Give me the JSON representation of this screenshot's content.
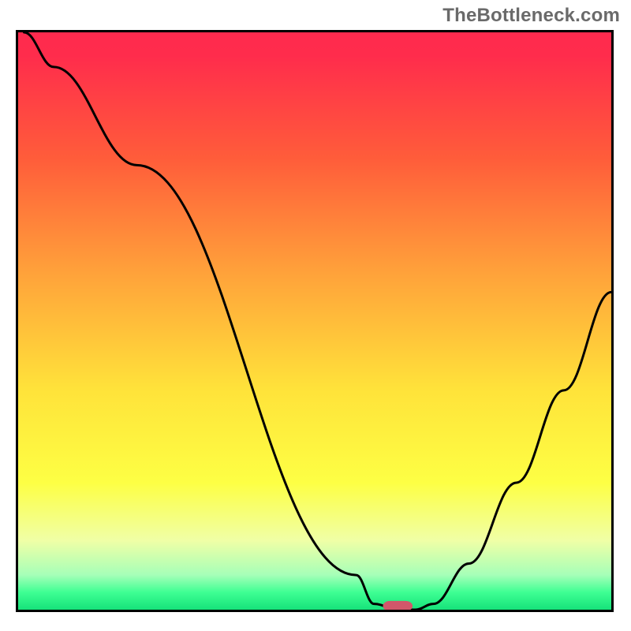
{
  "watermark": "TheBottleneck.com",
  "chart_data": {
    "type": "line",
    "title": "",
    "xlabel": "",
    "ylabel": "",
    "xlim": [
      0,
      100
    ],
    "ylim": [
      0,
      100
    ],
    "grid": false,
    "series": [
      {
        "name": "curve",
        "x": [
          1,
          6,
          20,
          57,
          60,
          64,
          67,
          70,
          76,
          84,
          92,
          100
        ],
        "y": [
          100,
          94,
          77,
          6,
          1,
          0,
          0,
          1,
          8,
          22,
          38,
          55
        ]
      }
    ],
    "marker": {
      "x": 64,
      "y": 0,
      "width": 5,
      "height": 1.8,
      "color": "#d1576a"
    },
    "gradient_stops": [
      {
        "offset": 0.0,
        "color": "#ff2a4e"
      },
      {
        "offset": 0.04,
        "color": "#ff2c4c"
      },
      {
        "offset": 0.22,
        "color": "#ff5d3a"
      },
      {
        "offset": 0.42,
        "color": "#ffa33a"
      },
      {
        "offset": 0.62,
        "color": "#ffe33a"
      },
      {
        "offset": 0.78,
        "color": "#fdff44"
      },
      {
        "offset": 0.88,
        "color": "#f0ffa6"
      },
      {
        "offset": 0.94,
        "color": "#a6ffb8"
      },
      {
        "offset": 0.97,
        "color": "#3eff93"
      },
      {
        "offset": 1.0,
        "color": "#16e27a"
      }
    ]
  }
}
